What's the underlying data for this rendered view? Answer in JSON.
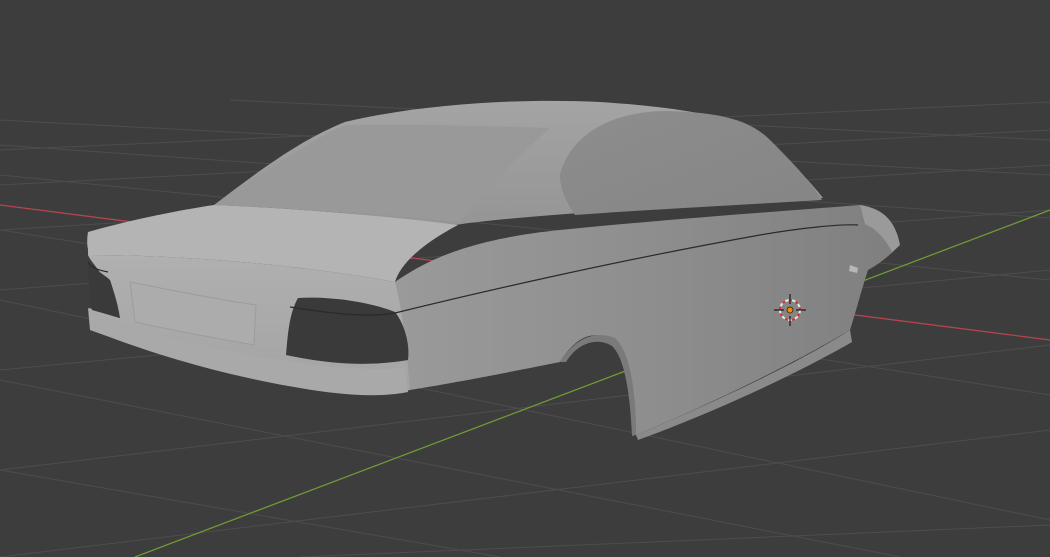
{
  "viewport": {
    "background_color": "#3d3d3d",
    "grid_color": "#505050",
    "x_axis_color": "#b7444c",
    "y_axis_color": "#6e9a33"
  },
  "scene": {
    "object": "car-body-mesh",
    "object_color": "#9c9c9c",
    "cursor_icon": "3d-cursor-icon",
    "origin_color": "#f08a00"
  }
}
